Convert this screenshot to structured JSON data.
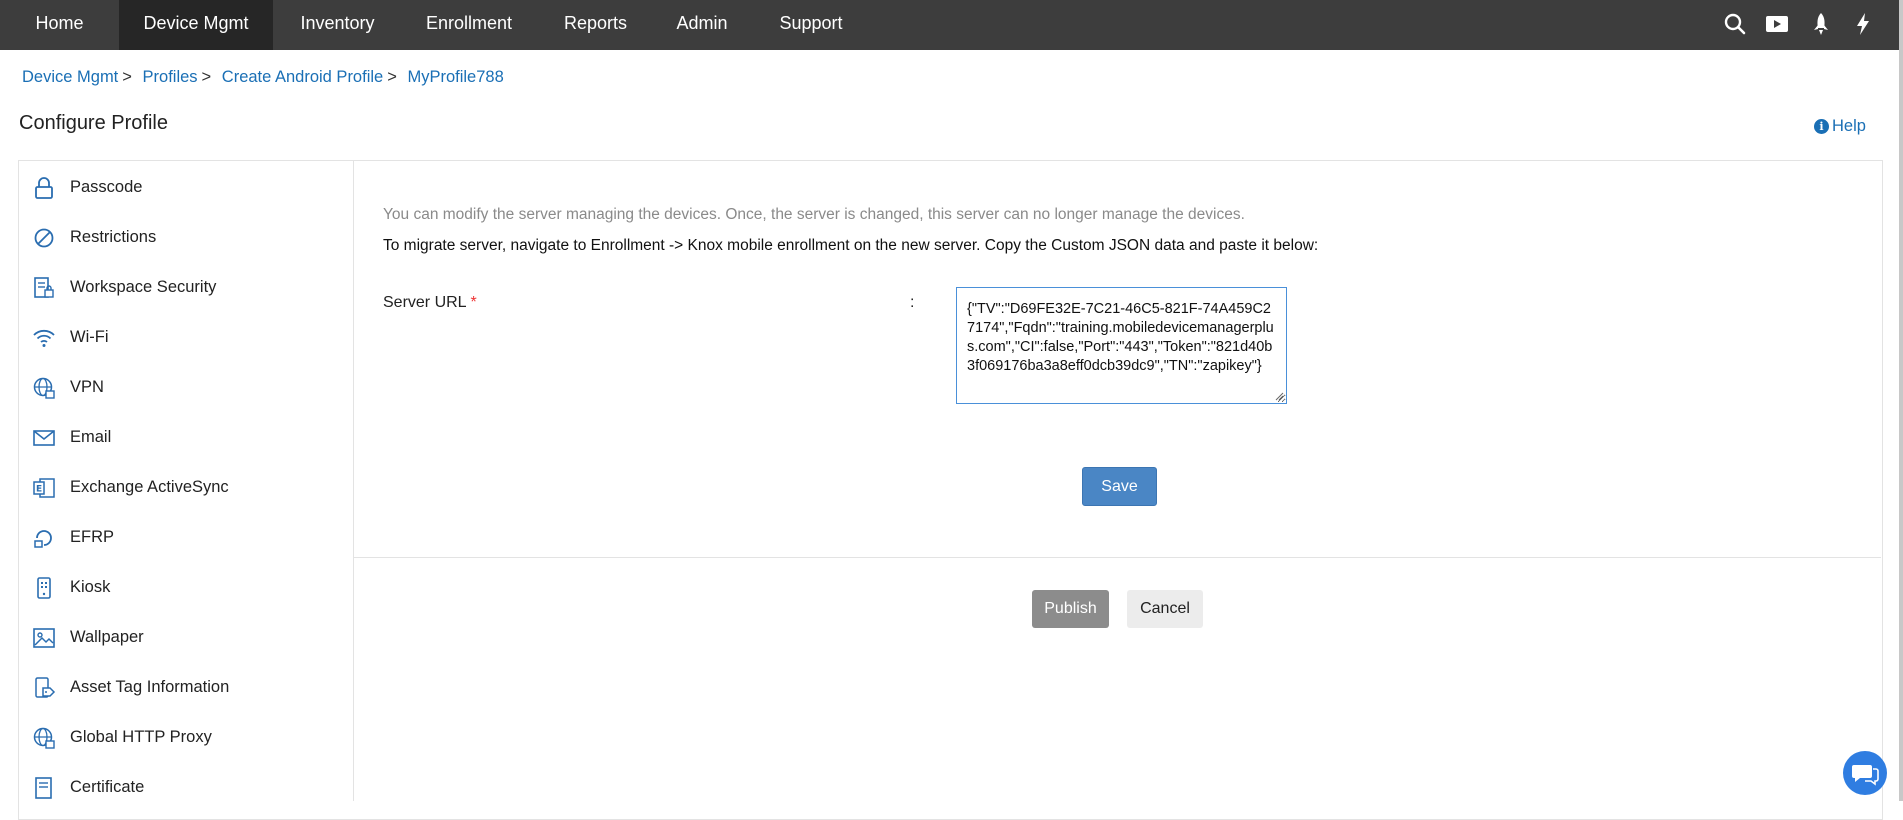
{
  "nav": {
    "items": [
      {
        "label": "Home",
        "active": false
      },
      {
        "label": "Device Mgmt",
        "active": true
      },
      {
        "label": "Inventory",
        "active": false
      },
      {
        "label": "Enrollment",
        "active": false
      },
      {
        "label": "Reports",
        "active": false
      },
      {
        "label": "Admin",
        "active": false
      },
      {
        "label": "Support",
        "active": false
      }
    ],
    "icons": [
      "search-icon",
      "video-icon",
      "rocket-icon",
      "flash-icon"
    ]
  },
  "breadcrumb": [
    "Device Mgmt",
    "Profiles",
    "Create Android Profile",
    "MyProfile788"
  ],
  "breadcrumb_separator": ">",
  "page_title": "Configure Profile",
  "help_label": "Help",
  "sidebar": {
    "items": [
      {
        "label": "Passcode",
        "icon": "lock-icon"
      },
      {
        "label": "Restrictions",
        "icon": "restriction-icon"
      },
      {
        "label": "Workspace Security",
        "icon": "workspace-security-icon"
      },
      {
        "label": "Wi-Fi",
        "icon": "wifi-icon"
      },
      {
        "label": "VPN",
        "icon": "globe-lock-icon"
      },
      {
        "label": "Email",
        "icon": "email-icon"
      },
      {
        "label": "Exchange ActiveSync",
        "icon": "exchange-icon"
      },
      {
        "label": "EFRP",
        "icon": "efrp-icon"
      },
      {
        "label": "Kiosk",
        "icon": "kiosk-icon"
      },
      {
        "label": "Wallpaper",
        "icon": "wallpaper-icon"
      },
      {
        "label": "Asset Tag Information",
        "icon": "asset-tag-icon"
      },
      {
        "label": "Global HTTP Proxy",
        "icon": "globe-icon"
      },
      {
        "label": "Certificate",
        "icon": "certificate-icon"
      }
    ]
  },
  "main": {
    "info_text": "You can modify the server managing the devices. Once, the server is changed, this server can no longer manage the devices.",
    "instruction_text": "To migrate server, navigate to Enrollment -> Knox mobile enrollment on the new server. Copy the Custom JSON data and paste it below:",
    "field_label": "Server URL",
    "required_mark": "*",
    "colon": ":",
    "server_url_value": "{\"TV\":\"D69FE32E-7C21-46C5-821F-74A459C27174\",\"Fqdn\":\"training.mobiledevicemanagerplus.com\",\"CI\":false,\"Port\":\"443\",\"Token\":\"821d40b3f069176ba3a8eff0dcb39dc9\",\"TN\":\"zapikey\"}",
    "save_label": "Save"
  },
  "footer": {
    "publish_label": "Publish",
    "cancel_label": "Cancel"
  },
  "colors": {
    "nav_bg": "#3d3d3d",
    "nav_active_bg": "#262626",
    "link": "#1a6fb5",
    "save_btn": "#4a86c5",
    "publish_btn": "#8c8c8c",
    "chat_btn": "#2f7de1"
  }
}
